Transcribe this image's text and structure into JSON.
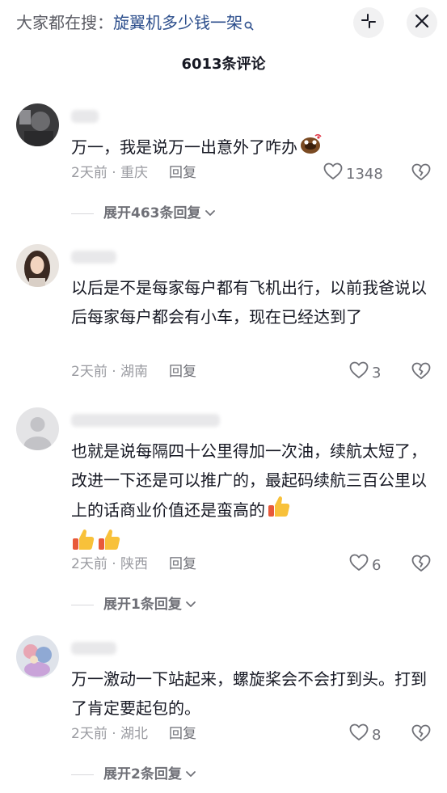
{
  "header": {
    "search_prefix": "大家都在搜：",
    "search_term": "旋翼机多少钱一架",
    "search_icon": "search-icon",
    "collapse_icon": "collapse-icon",
    "close_icon": "close-icon"
  },
  "comments_count": "6013条评论",
  "comments": [
    {
      "text": "万一，我是说万一出意外了咋办",
      "emoji": "laughing-emoji",
      "time": "2天前",
      "location": "重庆",
      "reply": "回复",
      "likes": "1348",
      "expand": "展开463条回复"
    },
    {
      "text": "以后是不是每家每户都有飞机出行，以前我爸说以后每家每户都会有小车，现在已经达到了",
      "time": "2天前",
      "location": "湖南",
      "reply": "回复",
      "likes": "3"
    },
    {
      "text": "也就是说每隔四十公里得加一次油，续航太短了，改进一下还是可以推广的，最起码续航三百公里以上的话商业价值还是蛮高的",
      "emoji": "thumbs-up-emoji",
      "time": "2天前",
      "location": "陕西",
      "reply": "回复",
      "likes": "6",
      "expand": "展开1条回复"
    },
    {
      "text": "万一激动一下站起来，螺旋桨会不会打到头。打到了肯定要起包的。",
      "time": "2天前",
      "location": "湖北",
      "reply": "回复",
      "likes": "8",
      "expand": "展开2条回复"
    }
  ],
  "meta_separator": " · ",
  "colors": {
    "term_blue": "#2c4e8c",
    "text": "#161823",
    "muted": "#9a9ba1",
    "thumb_yellow": "#f8c13a"
  }
}
